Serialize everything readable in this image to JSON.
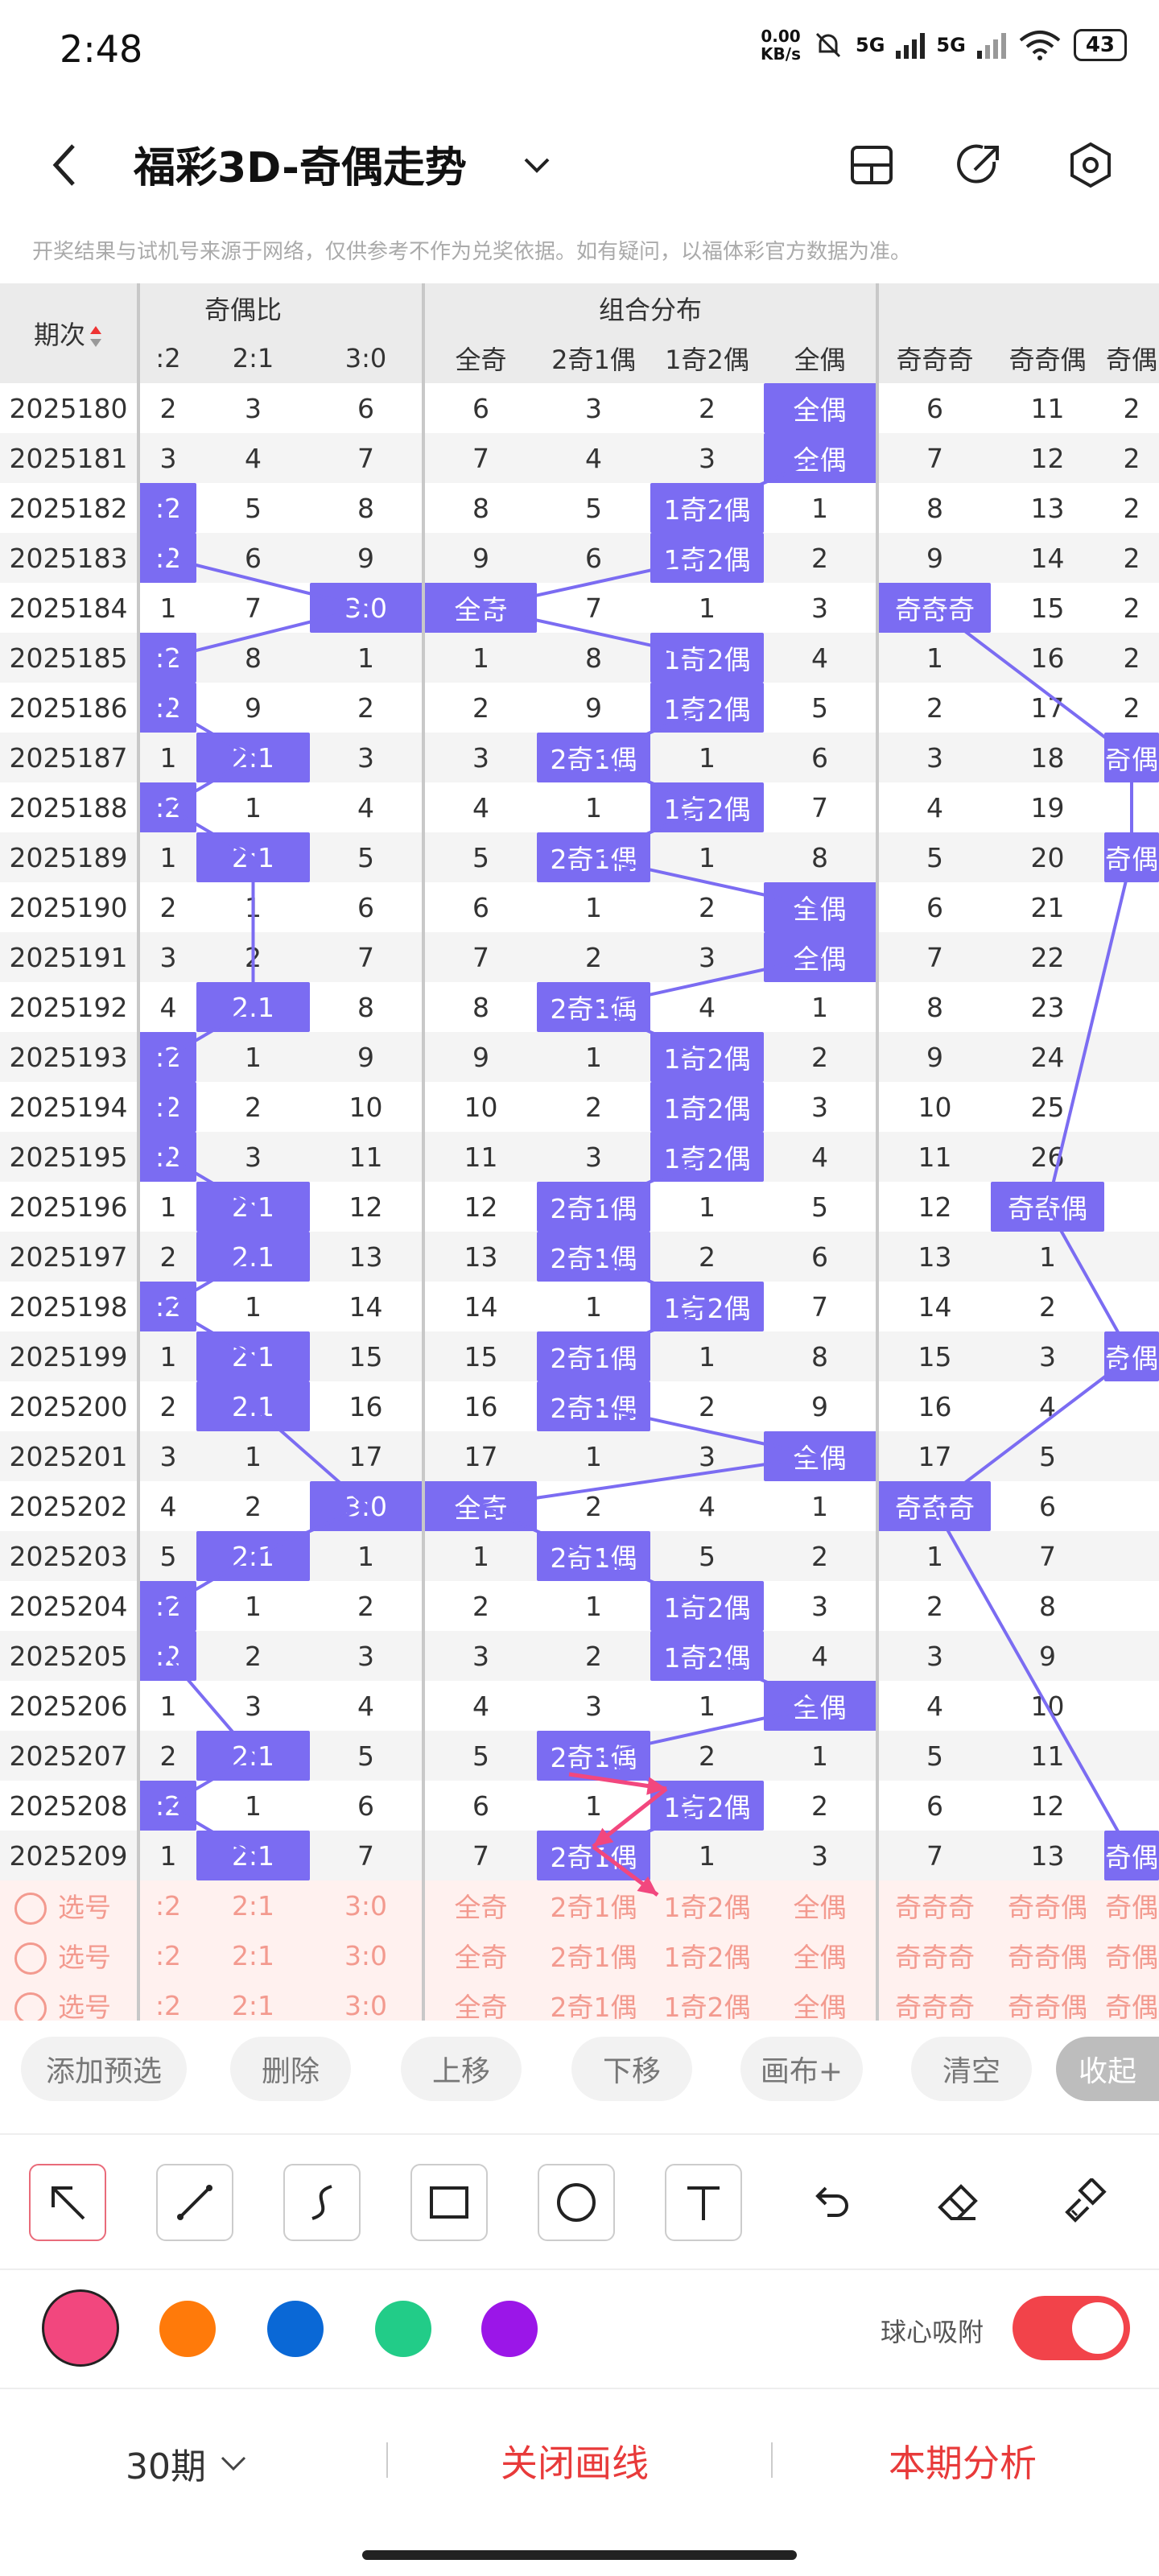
{
  "status_bar": {
    "time": "2:48",
    "net_rate_top": "0.00",
    "net_rate_bottom": "KB/s",
    "sig1": "5G",
    "sig2": "5G",
    "battery": "43"
  },
  "header": {
    "title": "福彩3D-奇偶走势"
  },
  "notice": "开奖结果与试机号来源于网络，仅供参考不作为兑奖依据。如有疑问，以福体彩官方数据为准。",
  "table": {
    "period_header": "期次",
    "groups": [
      {
        "label": "奇偶比"
      },
      {
        "label": "组合分布"
      },
      {
        "label": ""
      }
    ],
    "columns": [
      ":2",
      "2:1",
      "3:0",
      "全奇",
      "2奇1偶",
      "1奇2偶",
      "全偶",
      "奇奇奇",
      "奇奇偶",
      "奇偶"
    ],
    "rows": [
      {
        "p": "2025180",
        "c": [
          "2",
          "3",
          "6",
          "6",
          "3",
          "2",
          "全偶",
          "6",
          "11",
          "2"
        ],
        "h": [
          6
        ]
      },
      {
        "p": "2025181",
        "c": [
          "3",
          "4",
          "7",
          "7",
          "4",
          "3",
          "全偶",
          "7",
          "12",
          "2"
        ],
        "h": [
          6
        ]
      },
      {
        "p": "2025182",
        "c": [
          ":2",
          "5",
          "8",
          "8",
          "5",
          "1奇2偶",
          "1",
          "8",
          "13",
          "2"
        ],
        "h": [
          0,
          5
        ]
      },
      {
        "p": "2025183",
        "c": [
          ":2",
          "6",
          "9",
          "9",
          "6",
          "1奇2偶",
          "2",
          "9",
          "14",
          "2"
        ],
        "h": [
          0,
          5
        ]
      },
      {
        "p": "2025184",
        "c": [
          "1",
          "7",
          "3:0",
          "全奇",
          "7",
          "1",
          "3",
          "奇奇奇",
          "15",
          "2"
        ],
        "h": [
          2,
          3,
          7
        ]
      },
      {
        "p": "2025185",
        "c": [
          ":2",
          "8",
          "1",
          "1",
          "8",
          "1奇2偶",
          "4",
          "1",
          "16",
          "2"
        ],
        "h": [
          0,
          5
        ]
      },
      {
        "p": "2025186",
        "c": [
          ":2",
          "9",
          "2",
          "2",
          "9",
          "1奇2偶",
          "5",
          "2",
          "17",
          "2"
        ],
        "h": [
          0,
          5
        ]
      },
      {
        "p": "2025187",
        "c": [
          "1",
          "2:1",
          "3",
          "3",
          "2奇1偶",
          "1",
          "6",
          "3",
          "18",
          "奇偶"
        ],
        "h": [
          1,
          4,
          9
        ]
      },
      {
        "p": "2025188",
        "c": [
          ":2",
          "1",
          "4",
          "4",
          "1",
          "1奇2偶",
          "7",
          "4",
          "19",
          ""
        ],
        "h": [
          0,
          5
        ]
      },
      {
        "p": "2025189",
        "c": [
          "1",
          "2:1",
          "5",
          "5",
          "2奇1偶",
          "1",
          "8",
          "5",
          "20",
          "奇偶"
        ],
        "h": [
          1,
          4,
          9
        ]
      },
      {
        "p": "2025190",
        "c": [
          "2",
          "1",
          "6",
          "6",
          "1",
          "2",
          "全偶",
          "6",
          "21",
          ""
        ],
        "h": [
          6
        ]
      },
      {
        "p": "2025191",
        "c": [
          "3",
          "2",
          "7",
          "7",
          "2",
          "3",
          "全偶",
          "7",
          "22",
          ""
        ],
        "h": [
          6
        ]
      },
      {
        "p": "2025192",
        "c": [
          "4",
          "2:1",
          "8",
          "8",
          "2奇1偶",
          "4",
          "1",
          "8",
          "23",
          ""
        ],
        "h": [
          1,
          4
        ]
      },
      {
        "p": "2025193",
        "c": [
          ":2",
          "1",
          "9",
          "9",
          "1",
          "1奇2偶",
          "2",
          "9",
          "24",
          ""
        ],
        "h": [
          0,
          5
        ]
      },
      {
        "p": "2025194",
        "c": [
          ":2",
          "2",
          "10",
          "10",
          "2",
          "1奇2偶",
          "3",
          "10",
          "25",
          ""
        ],
        "h": [
          0,
          5
        ]
      },
      {
        "p": "2025195",
        "c": [
          ":2",
          "3",
          "11",
          "11",
          "3",
          "1奇2偶",
          "4",
          "11",
          "26",
          ""
        ],
        "h": [
          0,
          5
        ]
      },
      {
        "p": "2025196",
        "c": [
          "1",
          "2:1",
          "12",
          "12",
          "2奇1偶",
          "1",
          "5",
          "12",
          "奇奇偶",
          ""
        ],
        "h": [
          1,
          4,
          8
        ]
      },
      {
        "p": "2025197",
        "c": [
          "2",
          "2:1",
          "13",
          "13",
          "2奇1偶",
          "2",
          "6",
          "13",
          "1",
          ""
        ],
        "h": [
          1,
          4
        ]
      },
      {
        "p": "2025198",
        "c": [
          ":2",
          "1",
          "14",
          "14",
          "1",
          "1奇2偶",
          "7",
          "14",
          "2",
          ""
        ],
        "h": [
          0,
          5
        ]
      },
      {
        "p": "2025199",
        "c": [
          "1",
          "2:1",
          "15",
          "15",
          "2奇1偶",
          "1",
          "8",
          "15",
          "3",
          "奇偶"
        ],
        "h": [
          1,
          4,
          9
        ]
      },
      {
        "p": "2025200",
        "c": [
          "2",
          "2:1",
          "16",
          "16",
          "2奇1偶",
          "2",
          "9",
          "16",
          "4",
          ""
        ],
        "h": [
          1,
          4
        ]
      },
      {
        "p": "2025201",
        "c": [
          "3",
          "1",
          "17",
          "17",
          "1",
          "3",
          "全偶",
          "17",
          "5",
          ""
        ],
        "h": [
          6
        ]
      },
      {
        "p": "2025202",
        "c": [
          "4",
          "2",
          "3:0",
          "全奇",
          "2",
          "4",
          "1",
          "奇奇奇",
          "6",
          ""
        ],
        "h": [
          2,
          3,
          7
        ]
      },
      {
        "p": "2025203",
        "c": [
          "5",
          "2:1",
          "1",
          "1",
          "2奇1偶",
          "5",
          "2",
          "1",
          "7",
          ""
        ],
        "h": [
          1,
          4
        ]
      },
      {
        "p": "2025204",
        "c": [
          ":2",
          "1",
          "2",
          "2",
          "1",
          "1奇2偶",
          "3",
          "2",
          "8",
          ""
        ],
        "h": [
          0,
          5
        ]
      },
      {
        "p": "2025205",
        "c": [
          ":2",
          "2",
          "3",
          "3",
          "2",
          "1奇2偶",
          "4",
          "3",
          "9",
          ""
        ],
        "h": [
          0,
          5
        ]
      },
      {
        "p": "2025206",
        "c": [
          "1",
          "3",
          "4",
          "4",
          "3",
          "1",
          "全偶",
          "4",
          "10",
          ""
        ],
        "h": [
          6
        ]
      },
      {
        "p": "2025207",
        "c": [
          "2",
          "2:1",
          "5",
          "5",
          "2奇1偶",
          "2",
          "1",
          "5",
          "11",
          ""
        ],
        "h": [
          1,
          4
        ]
      },
      {
        "p": "2025208",
        "c": [
          ":2",
          "1",
          "6",
          "6",
          "1",
          "1奇2偶",
          "2",
          "6",
          "12",
          ""
        ],
        "h": [
          0,
          5
        ]
      },
      {
        "p": "2025209",
        "c": [
          "1",
          "2:1",
          "7",
          "7",
          "2奇1偶",
          "1",
          "3",
          "7",
          "13",
          "奇偶"
        ],
        "h": [
          1,
          4,
          9
        ]
      }
    ],
    "select_rows": [
      {
        "label": "选号",
        "c": [
          ":2",
          "2:1",
          "3:0",
          "全奇",
          "2奇1偶",
          "1奇2偶",
          "全偶",
          "奇奇奇",
          "奇奇偶",
          "奇偶"
        ]
      },
      {
        "label": "选号",
        "c": [
          ":2",
          "2:1",
          "3:0",
          "全奇",
          "2奇1偶",
          "1奇2偶",
          "全偶",
          "奇奇奇",
          "奇奇偶",
          "奇偶"
        ]
      },
      {
        "label": "选号",
        "c": [
          ":2",
          "2:1",
          "3:0",
          "全奇",
          "2奇1偶",
          "1奇2偶",
          "全偶",
          "奇奇奇",
          "奇奇偶",
          "奇偶"
        ]
      }
    ]
  },
  "actions": {
    "add_preselect": "添加预选",
    "delete": "删除",
    "move_up": "上移",
    "move_down": "下移",
    "canvas_plus": "画布+",
    "clear": "清空",
    "collapse": "收起"
  },
  "drawing": {
    "tools": [
      "arrow-tool-icon",
      "line-tool-icon",
      "curve-tool-icon",
      "rectangle-tool-icon",
      "circle-tool-icon",
      "text-tool-icon",
      "undo-icon",
      "eraser-icon",
      "clear-brush-icon"
    ],
    "colors": [
      "#f2477e",
      "#ff7a0a",
      "#0a68d6",
      "#22cc88",
      "#9b16e8"
    ],
    "snap_label": "球心吸附",
    "snap_on": true
  },
  "bottom_nav": {
    "period_select": "30期",
    "close_lines": "关闭画线",
    "analysis": "本期分析"
  },
  "theme": {
    "highlight": "#7b6cf2",
    "accent_red": "#e83a3a",
    "select_pink": "#f39a8f"
  }
}
